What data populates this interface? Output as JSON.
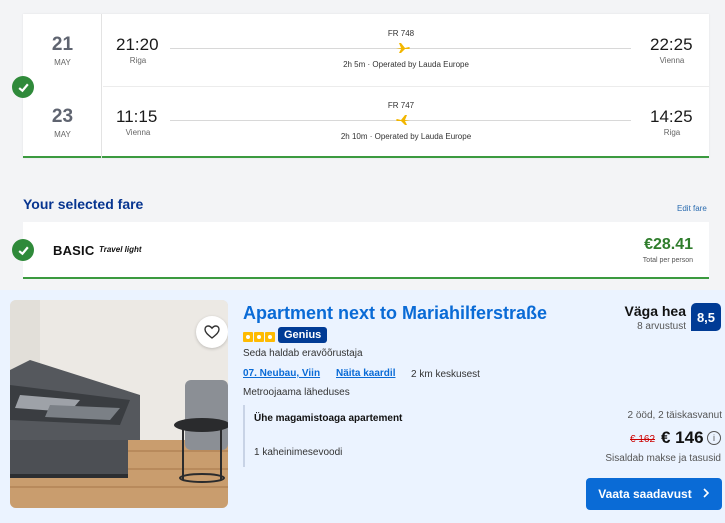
{
  "flights": [
    {
      "day": "21",
      "month": "MAY",
      "dep_time": "21:20",
      "dep_city": "Riga",
      "flight_no": "FR 748",
      "duration": "2h 5m · Operated by Lauda Europe",
      "arr_time": "22:25",
      "arr_city": "Vienna"
    },
    {
      "day": "23",
      "month": "MAY",
      "dep_time": "11:15",
      "dep_city": "Vienna",
      "flight_no": "FR 747",
      "duration": "2h 10m · Operated by Lauda Europe",
      "arr_time": "14:25",
      "arr_city": "Riga"
    }
  ],
  "fare": {
    "heading": "Your selected fare",
    "edit": "Edit fare",
    "name": "BASIC",
    "tagline": "Travel light",
    "price": "€28.41",
    "price_note": "Total per person"
  },
  "hotel": {
    "title": "Apartment next to Mariahilferstraße",
    "genius": "Genius",
    "managed_by": "Seda haldab eravõõrustaja",
    "district": "07. Neubau, Viin",
    "map_link": "Näita kaardil",
    "distance": "2 km keskusest",
    "metro": "Metroojaama läheduses",
    "room": "Ühe magamistoaga apartement",
    "bed": "1 kaheinimesevoodi",
    "rating_label": "Väga hea",
    "reviews": "8 arvustust",
    "score": "8,5",
    "nights": "2 ööd, 2 täiskasvanut",
    "old_price": "€ 162",
    "price": "€ 146",
    "taxes": "Sisaldab makse ja tasusid",
    "cta": "Vaata saadavust"
  },
  "colors": {
    "accent_blue": "#0a6bd6",
    "dark_blue": "#003b95",
    "success_green": "#2f8a3a",
    "star_yellow": "#febb02"
  }
}
